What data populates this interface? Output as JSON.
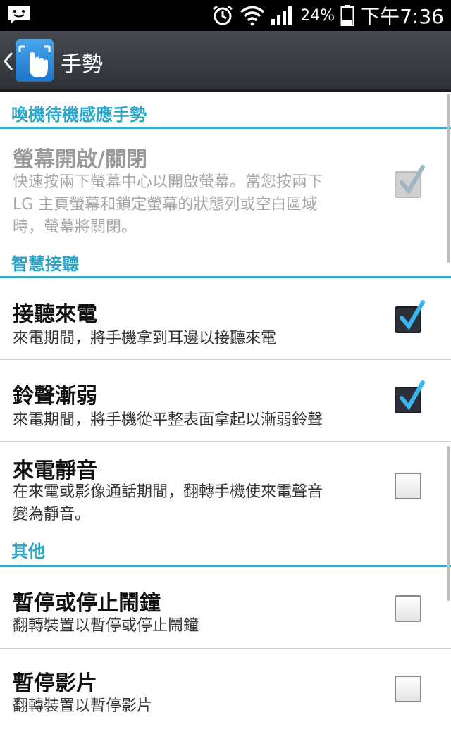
{
  "status_bar": {
    "notification_icon": "chat-notification-icon",
    "alarm_icon": "alarm-clock-icon",
    "wifi_icon": "wifi-icon",
    "signal_icon": "cell-signal-icon",
    "battery_percent": "24%",
    "battery_icon": "battery-icon",
    "time": "下午7:36"
  },
  "action_bar": {
    "title": "手勢",
    "back_icon": "chevron-left-icon",
    "app_icon": "gesture-hand-icon"
  },
  "sections": [
    {
      "header": "喚機待機感應手勢",
      "items": [
        {
          "title": "螢幕開啟/關閉",
          "summary": "快速按兩下螢幕中心以開啟螢幕。當您按兩下 LG 主頁螢幕和鎖定螢幕的狀態列或空白區域時，螢幕將關閉。",
          "summary_lines": [
            "快速按兩下螢幕中心以開啟螢幕。當您按兩下",
            "LG 主頁螢幕和鎖定螢幕的狀態列或空白區域",
            "時，螢幕將關閉。"
          ],
          "checked": true,
          "enabled": false
        }
      ]
    },
    {
      "header": "智慧接聽",
      "items": [
        {
          "title": "接聽來電",
          "summary_lines": [
            "來電期間，將手機拿到耳邊以接聽來電"
          ],
          "checked": true,
          "enabled": true
        },
        {
          "title": "鈴聲漸弱",
          "summary_lines": [
            "來電期間，將手機從平整表面拿起以漸弱鈴聲"
          ],
          "checked": true,
          "enabled": true
        },
        {
          "title": "來電靜音",
          "summary_lines": [
            "在來電或影像通話期間，翻轉手機使來電聲音",
            "變為靜音。"
          ],
          "checked": false,
          "enabled": true
        }
      ]
    },
    {
      "header": "其他",
      "items": [
        {
          "title": "暫停或停止鬧鐘",
          "summary_lines": [
            "翻轉裝置以暫停或停止鬧鐘"
          ],
          "checked": false,
          "enabled": true
        },
        {
          "title": "暫停影片",
          "summary_lines": [
            "翻轉裝置以暫停影片"
          ],
          "checked": false,
          "enabled": true
        }
      ]
    }
  ],
  "colors": {
    "section_accent": "#2aa6c8",
    "action_bar": "#3b4046",
    "status_bar": "#000000"
  }
}
